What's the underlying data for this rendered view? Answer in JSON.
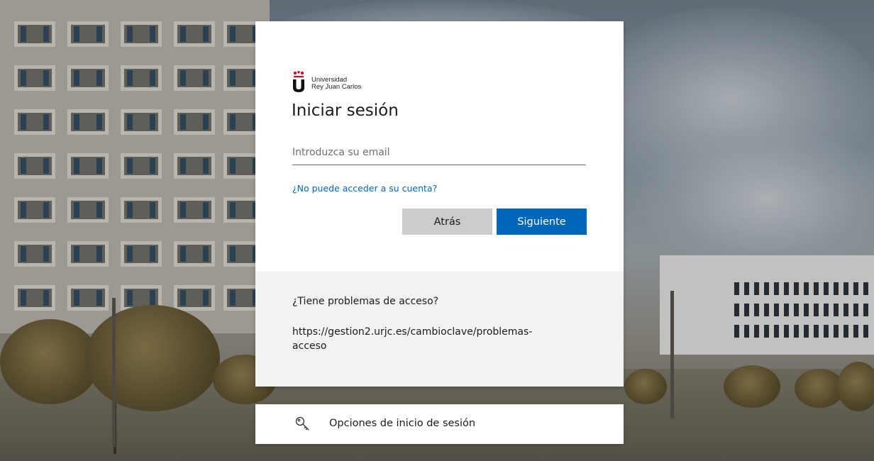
{
  "brand": {
    "line1": "Universidad",
    "line2": "Rey Juan Carlos",
    "accent_color": "#c8102e"
  },
  "login": {
    "title": "Iniciar sesión",
    "email_placeholder": "Introduzca su email",
    "email_value": "",
    "cant_access_link": "¿No puede acceder a su cuenta?",
    "back_label": "Atrás",
    "next_label": "Siguiente",
    "primary_color": "#0067b8"
  },
  "help": {
    "title": "¿Tiene problemas de acceso?",
    "link_text": "https://gestion2.urjc.es/cambioclave/problemas-acceso"
  },
  "signin_options": {
    "label": "Opciones de inicio de sesión",
    "icon": "key-icon"
  }
}
